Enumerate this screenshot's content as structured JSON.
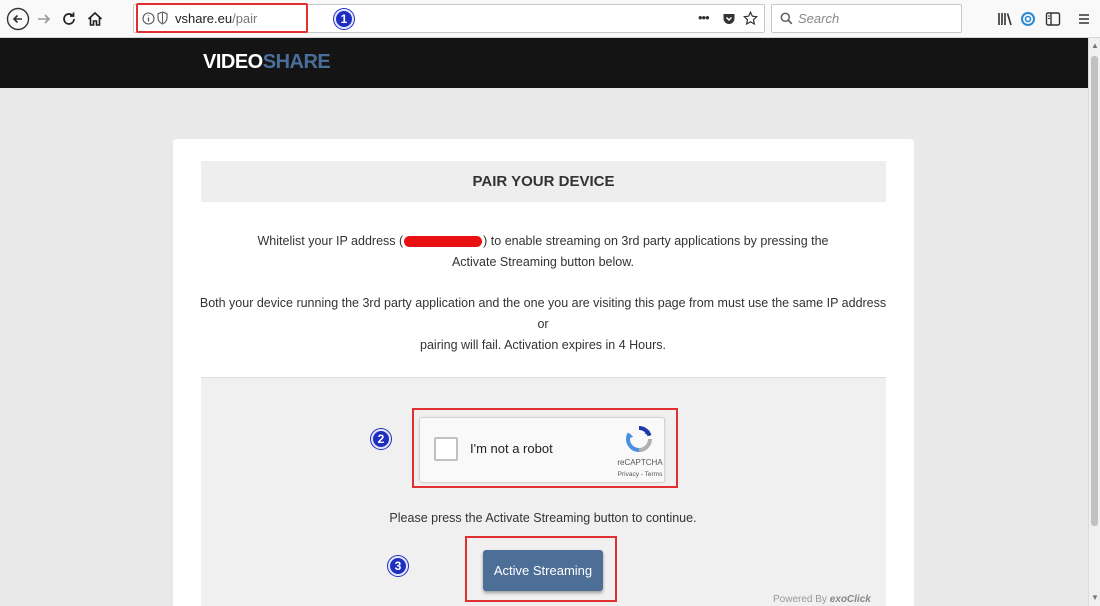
{
  "browser": {
    "url_host": "vshare.eu",
    "url_path": "/pair",
    "search_placeholder": "Search",
    "page_actions": "•••"
  },
  "annotations": [
    "1",
    "2",
    "3"
  ],
  "site": {
    "logo_part1": "VIDEO",
    "logo_part2": "SHARE"
  },
  "card": {
    "title": "PAIR YOUR DEVICE",
    "intro_before": "Whitelist your IP address (",
    "intro_after": ") to enable streaming on 3rd party applications by pressing the",
    "intro_line2": "Activate Streaming button below.",
    "note_line1": "Both your device running the 3rd party application and the one you are visiting this page from must use the same IP address or",
    "note_line2": "pairing will fail. Activation expires in 4 Hours.",
    "recaptcha": {
      "label": "I'm not a robot",
      "brand": "reCAPTCHA",
      "links": "Privacy - Terms"
    },
    "continue_text": "Please press the Activate Streaming button to continue.",
    "button_label": "Active Streaming",
    "powered_by": "Powered By",
    "powered_brand": "exoClick"
  },
  "colors": {
    "header_bg": "#141414",
    "logo_accent": "#4a6e9a",
    "button_bg": "#4d6f97",
    "highlight": "#e03030",
    "badge": "#1d2fbf"
  }
}
